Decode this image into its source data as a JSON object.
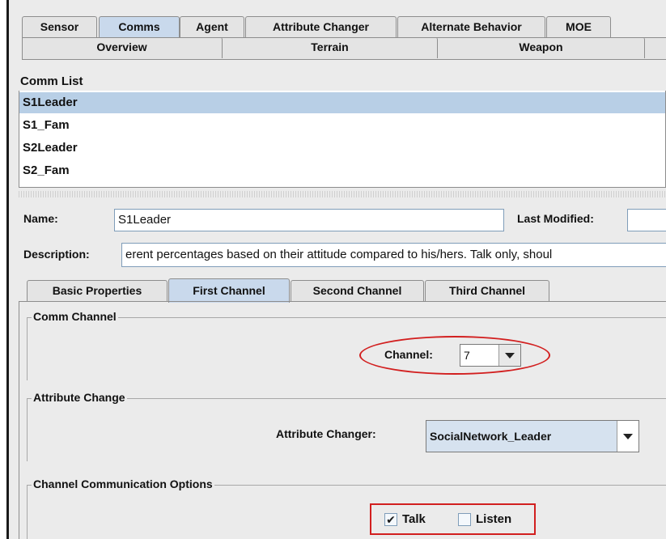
{
  "top_tabs_row1": [
    {
      "label": "Sensor",
      "selected": false
    },
    {
      "label": "Comms",
      "selected": true
    },
    {
      "label": "Agent",
      "selected": false
    },
    {
      "label": "Attribute Changer",
      "selected": false
    },
    {
      "label": "Alternate Behavior",
      "selected": false
    },
    {
      "label": "MOE",
      "selected": false
    }
  ],
  "top_tabs_row2": [
    {
      "label": "Overview"
    },
    {
      "label": "Terrain"
    },
    {
      "label": "Weapon"
    }
  ],
  "comm_list": {
    "header": "Comm List",
    "items": [
      "S1Leader",
      "S1_Fam",
      "S2Leader",
      "S2_Fam"
    ],
    "selected": "S1Leader"
  },
  "form": {
    "name_label": "Name:",
    "name_value": "S1Leader",
    "last_modified_label": "Last Modified:",
    "last_modified_value": "",
    "description_label": "Description:",
    "description_value": "erent percentages based on their attitude compared to his/hers.  Talk only, shoul"
  },
  "sub_tabs": [
    {
      "label": "Basic Properties",
      "selected": false
    },
    {
      "label": "First Channel",
      "selected": true
    },
    {
      "label": "Second Channel",
      "selected": false
    },
    {
      "label": "Third Channel",
      "selected": false
    }
  ],
  "comm_channel": {
    "title": "Comm Channel",
    "channel_label": "Channel:",
    "channel_value": "7"
  },
  "attribute_change": {
    "title": "Attribute Change",
    "changer_label": "Attribute Changer:",
    "changer_value": "SocialNetwork_Leader"
  },
  "channel_options": {
    "title": "Channel Communication Options",
    "talk_label": "Talk",
    "talk_checked": true,
    "listen_label": "Listen",
    "listen_checked": false
  },
  "colors": {
    "highlight": "#d21f1f",
    "selection": "#b8cfe6",
    "selected_tab": "#c9d9ec"
  }
}
